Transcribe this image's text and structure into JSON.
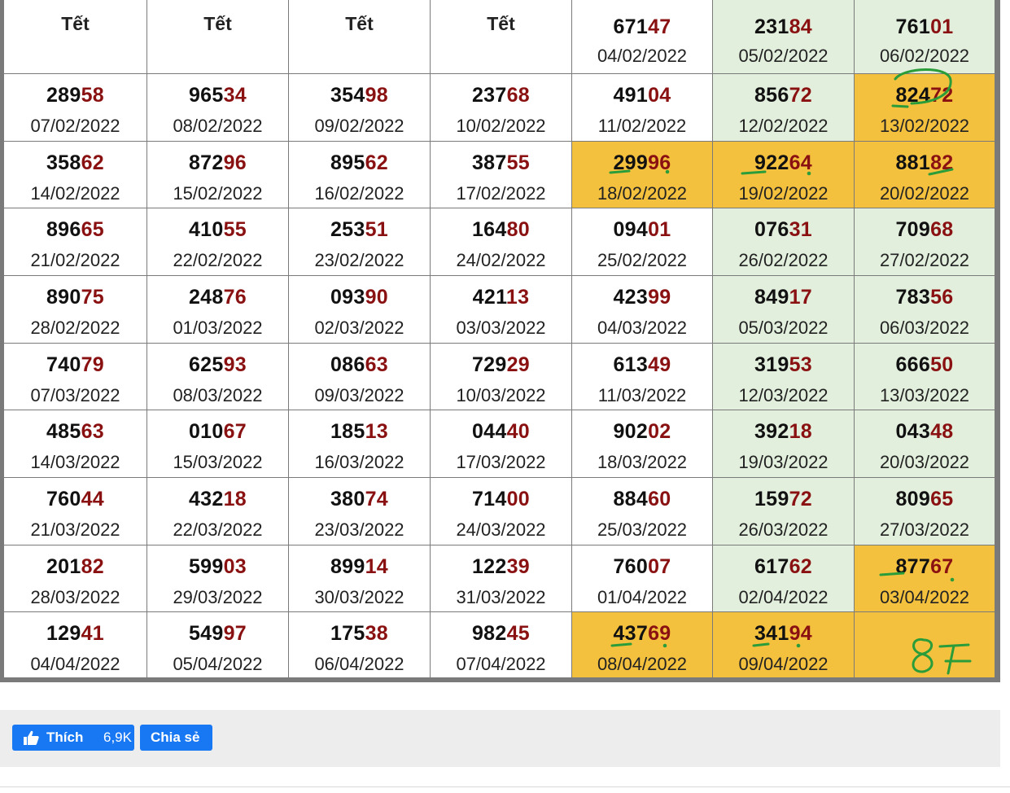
{
  "rows": [
    [
      {
        "tet": "Tết"
      },
      {
        "tet": "Tết"
      },
      {
        "tet": "Tết"
      },
      {
        "tet": "Tết"
      },
      {
        "head": "671",
        "tail": "47",
        "date": "04/02/2022"
      },
      {
        "head": "231",
        "tail": "84",
        "date": "05/02/2022"
      },
      {
        "head": "761",
        "tail": "01",
        "date": "06/02/2022"
      }
    ],
    [
      {
        "head": "289",
        "tail": "58",
        "date": "07/02/2022"
      },
      {
        "head": "965",
        "tail": "34",
        "date": "08/02/2022"
      },
      {
        "head": "354",
        "tail": "98",
        "date": "09/02/2022"
      },
      {
        "head": "237",
        "tail": "68",
        "date": "10/02/2022"
      },
      {
        "head": "491",
        "tail": "04",
        "date": "11/02/2022"
      },
      {
        "head": "856",
        "tail": "72",
        "date": "12/02/2022"
      },
      {
        "head": "824",
        "tail": "72",
        "date": "13/02/2022"
      }
    ],
    [
      {
        "head": "358",
        "tail": "62",
        "date": "14/02/2022"
      },
      {
        "head": "872",
        "tail": "96",
        "date": "15/02/2022"
      },
      {
        "head": "895",
        "tail": "62",
        "date": "16/02/2022"
      },
      {
        "head": "387",
        "tail": "55",
        "date": "17/02/2022"
      },
      {
        "head": "299",
        "tail": "96",
        "date": "18/02/2022"
      },
      {
        "head": "922",
        "tail": "64",
        "date": "19/02/2022"
      },
      {
        "head": "881",
        "tail": "82",
        "date": "20/02/2022"
      }
    ],
    [
      {
        "head": "896",
        "tail": "65",
        "date": "21/02/2022"
      },
      {
        "head": "410",
        "tail": "55",
        "date": "22/02/2022"
      },
      {
        "head": "253",
        "tail": "51",
        "date": "23/02/2022"
      },
      {
        "head": "164",
        "tail": "80",
        "date": "24/02/2022"
      },
      {
        "head": "094",
        "tail": "01",
        "date": "25/02/2022"
      },
      {
        "head": "076",
        "tail": "31",
        "date": "26/02/2022"
      },
      {
        "head": "709",
        "tail": "68",
        "date": "27/02/2022"
      }
    ],
    [
      {
        "head": "890",
        "tail": "75",
        "date": "28/02/2022"
      },
      {
        "head": "248",
        "tail": "76",
        "date": "01/03/2022"
      },
      {
        "head": "093",
        "tail": "90",
        "date": "02/03/2022"
      },
      {
        "head": "421",
        "tail": "13",
        "date": "03/03/2022"
      },
      {
        "head": "423",
        "tail": "99",
        "date": "04/03/2022"
      },
      {
        "head": "849",
        "tail": "17",
        "date": "05/03/2022"
      },
      {
        "head": "783",
        "tail": "56",
        "date": "06/03/2022"
      }
    ],
    [
      {
        "head": "740",
        "tail": "79",
        "date": "07/03/2022"
      },
      {
        "head": "625",
        "tail": "93",
        "date": "08/03/2022"
      },
      {
        "head": "086",
        "tail": "63",
        "date": "09/03/2022"
      },
      {
        "head": "729",
        "tail": "29",
        "date": "10/03/2022"
      },
      {
        "head": "613",
        "tail": "49",
        "date": "11/03/2022"
      },
      {
        "head": "319",
        "tail": "53",
        "date": "12/03/2022"
      },
      {
        "head": "666",
        "tail": "50",
        "date": "13/03/2022"
      }
    ],
    [
      {
        "head": "485",
        "tail": "63",
        "date": "14/03/2022"
      },
      {
        "head": "010",
        "tail": "67",
        "date": "15/03/2022"
      },
      {
        "head": "185",
        "tail": "13",
        "date": "16/03/2022"
      },
      {
        "head": "044",
        "tail": "40",
        "date": "17/03/2022"
      },
      {
        "head": "902",
        "tail": "02",
        "date": "18/03/2022"
      },
      {
        "head": "392",
        "tail": "18",
        "date": "19/03/2022"
      },
      {
        "head": "043",
        "tail": "48",
        "date": "20/03/2022"
      }
    ],
    [
      {
        "head": "760",
        "tail": "44",
        "date": "21/03/2022"
      },
      {
        "head": "432",
        "tail": "18",
        "date": "22/03/2022"
      },
      {
        "head": "380",
        "tail": "74",
        "date": "23/03/2022"
      },
      {
        "head": "714",
        "tail": "00",
        "date": "24/03/2022"
      },
      {
        "head": "884",
        "tail": "60",
        "date": "25/03/2022"
      },
      {
        "head": "159",
        "tail": "72",
        "date": "26/03/2022"
      },
      {
        "head": "809",
        "tail": "65",
        "date": "27/03/2022"
      }
    ],
    [
      {
        "head": "201",
        "tail": "82",
        "date": "28/03/2022"
      },
      {
        "head": "599",
        "tail": "03",
        "date": "29/03/2022"
      },
      {
        "head": "899",
        "tail": "14",
        "date": "30/03/2022"
      },
      {
        "head": "122",
        "tail": "39",
        "date": "31/03/2022"
      },
      {
        "head": "760",
        "tail": "07",
        "date": "01/04/2022"
      },
      {
        "head": "617",
        "tail": "62",
        "date": "02/04/2022"
      },
      {
        "head": "877",
        "tail": "67",
        "date": "03/04/2022"
      }
    ],
    [
      {
        "head": "129",
        "tail": "41",
        "date": "04/04/2022"
      },
      {
        "head": "549",
        "tail": "97",
        "date": "05/04/2022"
      },
      {
        "head": "175",
        "tail": "38",
        "date": "06/04/2022"
      },
      {
        "head": "982",
        "tail": "45",
        "date": "07/04/2022"
      },
      {
        "head": "437",
        "tail": "69",
        "date": "08/04/2022"
      },
      {
        "head": "341",
        "tail": "94",
        "date": "09/04/2022"
      },
      {
        "handwritten": "87"
      }
    ]
  ],
  "highlighted_cells": [
    "1-6",
    "2-4",
    "2-5",
    "2-6",
    "8-6",
    "9-4",
    "9-5",
    "9-6"
  ],
  "colors": {
    "grid": "#7a7a7a",
    "weekend_bg": "#e2efdd",
    "highlight_bg": "#f4c13e",
    "tail_digits": "#8a1111",
    "pen": "#2a9d3a",
    "facebook_blue": "#1877f2"
  },
  "footer": {
    "like_label": "Thích",
    "like_count": "6,9K",
    "share_label": "Chia sẻ",
    "like_icon": "thumbs-up-icon"
  }
}
